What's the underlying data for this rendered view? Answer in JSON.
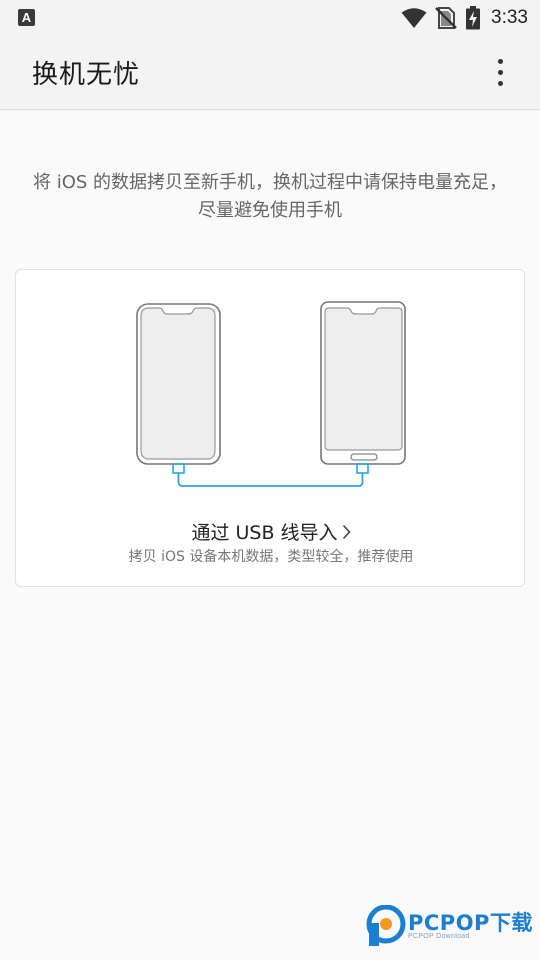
{
  "status_bar": {
    "time": "3:33",
    "left_icon_letter": "A",
    "icons": [
      "notification-a-icon",
      "wifi-icon",
      "no-sim-icon",
      "battery-charging-icon"
    ]
  },
  "app_bar": {
    "title": "换机无忧",
    "more_icon": "more-vertical-icon"
  },
  "intro_text": "将 iOS 的数据拷贝至新手机，换机过程中请保持电量充足，尽量避免使用手机",
  "usb_card": {
    "title": "通过 USB 线导入",
    "description": "拷贝 iOS 设备本机数据，类型较全，推荐使用",
    "accent_color": "#2aa7e0",
    "illustration_icons": [
      "iphone-icon",
      "android-phone-icon",
      "usb-cable-icon",
      "chevron-right-icon"
    ]
  },
  "watermark": {
    "brand": "PCPOP下载",
    "sub": "PCPOP Download",
    "color": "#1a7fd0"
  }
}
